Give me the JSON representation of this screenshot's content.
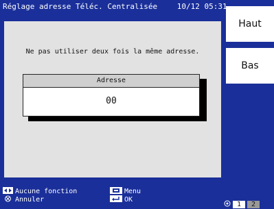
{
  "header": {
    "title": "Réglage adresse Téléc. Centralisée",
    "datetime": "10/12 05:31"
  },
  "main": {
    "message": "Ne pas utiliser deux fois la même adresse.",
    "dialog": {
      "header": "Adresse",
      "value": "00"
    }
  },
  "side_buttons": {
    "up_label": "Haut",
    "down_label": "Bas"
  },
  "legend": {
    "arrows_label": "Aucune fonction",
    "cancel_label": "Annuler",
    "menu_label": "Menu",
    "ok_label": "OK"
  },
  "pagination": {
    "pages": [
      "1",
      "2"
    ],
    "current": "1"
  },
  "colors": {
    "background": "#1a2f99",
    "panel": "#e2e2e2",
    "dialog_header": "#cfcfcf",
    "button": "#ffffff"
  }
}
